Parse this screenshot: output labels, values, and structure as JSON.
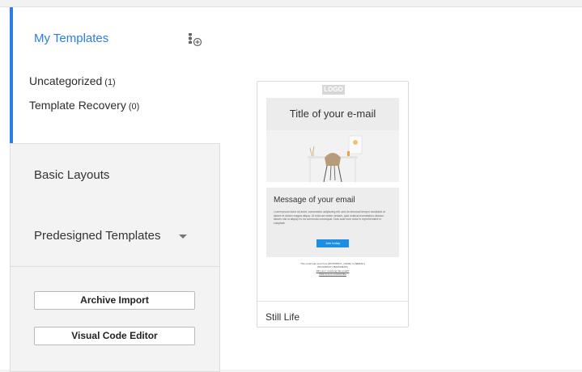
{
  "sidebar": {
    "my_templates": {
      "title": "My Templates",
      "add_icon": "add-folder-icon",
      "folders": [
        {
          "label": "Uncategorized",
          "count": "(1)"
        },
        {
          "label": "Template Recovery",
          "count": "(0)"
        }
      ]
    },
    "sections": {
      "basic_layouts": "Basic Layouts",
      "predesigned_templates": "Predesigned Templates"
    },
    "buttons": {
      "archive_import": "Archive Import",
      "visual_code_editor": "Visual Code Editor"
    }
  },
  "template_card": {
    "name": "Still Life",
    "preview": {
      "logo": "LOGO",
      "hero_title": "Title of your e-mail",
      "message_title": "Message of your email",
      "body_text": "Lorem ipsum dolor sit amet, consectetur adipiscing elit, sed do eiusmod tempor incididunt ut labore et dolore magna aliqua. Ut enim ad minim veniam, quis nostrud exercitation ullamco laboris nisi ut aliquip ex ea commodo consequat. Duis aute irure dolor in reprehenderit in voluptate",
      "cta": "Join today",
      "footer_1": "This email was sent from {$COMPANY_NAME} to {$EMAIL}",
      "footer_2": "{$COMPANY} {$ADDRESS}",
      "footer_link_1": "Why am I receiving this email?",
      "footer_link_2": "Click here to unsubscribe"
    }
  },
  "colors": {
    "accent": "#2b7de9",
    "cta": "#1a8fe3"
  }
}
